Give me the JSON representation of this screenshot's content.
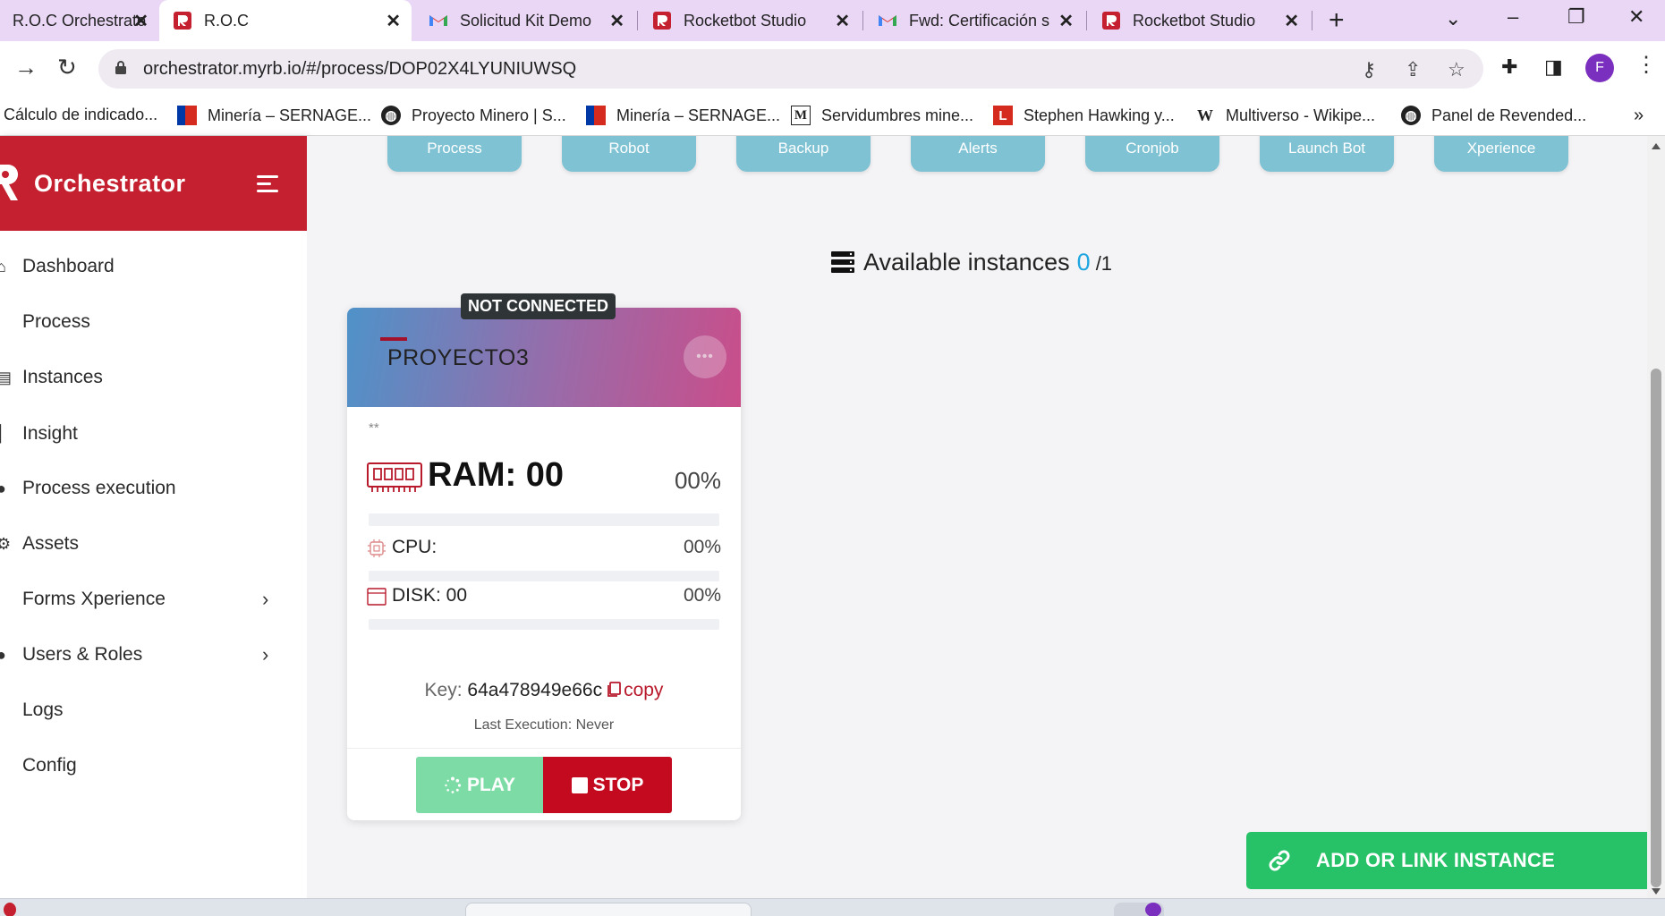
{
  "browser": {
    "tabs": [
      {
        "label": "R.O.C Orchestrator",
        "active": false
      },
      {
        "label": "R.O.C",
        "active": true
      },
      {
        "label": "Solicitud Kit Demo",
        "active": false
      },
      {
        "label": "Rocketbot Studio",
        "active": false
      },
      {
        "label": "Fwd: Certificación s",
        "active": false
      },
      {
        "label": "Rocketbot Studio",
        "active": false
      }
    ],
    "close_glyph": "✕",
    "new_tab_glyph": "+",
    "url": "orchestrator.myrb.io/#/process/DOP02X4LYUNIUWSQ",
    "profile_initial": "F",
    "bookmarks": [
      {
        "label": "Cálculo de indicado..."
      },
      {
        "label": "Minería – SERNAGE..."
      },
      {
        "label": "Proyecto Minero | S..."
      },
      {
        "label": "Minería – SERNAGE..."
      },
      {
        "label": "Servidumbres mine..."
      },
      {
        "label": "Stephen Hawking y..."
      },
      {
        "label": "Multiverso - Wikipe..."
      },
      {
        "label": "Panel de Revended..."
      }
    ],
    "bookmarks_more": "»"
  },
  "sidebar": {
    "brand": "Orchestrator",
    "items": [
      {
        "label": "Dashboard",
        "has_submenu": false
      },
      {
        "label": "Process",
        "has_submenu": false
      },
      {
        "label": "Instances",
        "has_submenu": false
      },
      {
        "label": "Insight",
        "has_submenu": false
      },
      {
        "label": "Process execution",
        "has_submenu": false
      },
      {
        "label": "Assets",
        "has_submenu": false
      },
      {
        "label": "Forms Xperience",
        "has_submenu": true
      },
      {
        "label": "Users & Roles",
        "has_submenu": true
      },
      {
        "label": "Logs",
        "has_submenu": false
      },
      {
        "label": "Config",
        "has_submenu": false
      }
    ],
    "chevron": "›"
  },
  "top_buttons": [
    "Process",
    "Robot",
    "Backup",
    "Alerts",
    "Cronjob",
    "Launch Bot",
    "Xperience"
  ],
  "instances": {
    "title": "Available instances",
    "available": "0",
    "total": "/1"
  },
  "card": {
    "status": "NOT CONNECTED",
    "name": "PROYECTO3",
    "more_glyph": "•••",
    "subtitle": "**",
    "ram_label": "RAM: 00",
    "ram_pct": "00%",
    "ram_fraction": 0,
    "cpu_label": "CPU:",
    "cpu_pct": "00%",
    "cpu_fraction": 0,
    "disk_label": "DISK: 00",
    "disk_pct": "00%",
    "disk_fraction": 0,
    "key_label": "Key:",
    "key_value": "64a478949e66c",
    "copy_label": "copy",
    "last_execution": "Last Execution: Never",
    "play_label": "PLAY",
    "stop_label": "STOP"
  },
  "add_instance_label": "ADD OR LINK INSTANCE",
  "colors": {
    "brand_red": "#c5202f",
    "top_button": "#7fc2d3",
    "play_green": "#7ddba6",
    "stop_red": "#c30a1f",
    "add_green": "#27c268",
    "count_blue": "#1fa6e0"
  }
}
